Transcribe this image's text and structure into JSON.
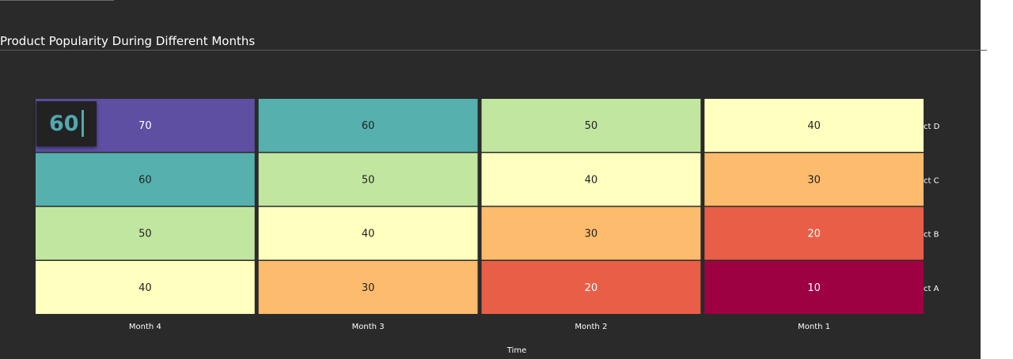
{
  "title": "Product Popularity During Different Months",
  "tooltip": {
    "value": "60"
  },
  "chart_data": {
    "type": "heatmap",
    "title": "Product Popularity During Different Months",
    "xlabel": "Time",
    "ylabel": "",
    "x": [
      "Month 4",
      "Month 3",
      "Month 2",
      "Month 1"
    ],
    "y": [
      "Product D",
      "Product C",
      "Product B",
      "Product A"
    ],
    "y_visible": [
      "ct D",
      "ct C",
      "ct B",
      "ct A"
    ],
    "values": [
      [
        70,
        60,
        50,
        40
      ],
      [
        60,
        50,
        40,
        30
      ],
      [
        50,
        40,
        30,
        20
      ],
      [
        40,
        30,
        20,
        10
      ]
    ],
    "colors": {
      "10": "#9e0142",
      "20": "#e95e47",
      "30": "#fdbb6d",
      "40": "#ffffbf",
      "50": "#c1e6a0",
      "60": "#55b0ae",
      "70": "#5e4fa2"
    }
  }
}
